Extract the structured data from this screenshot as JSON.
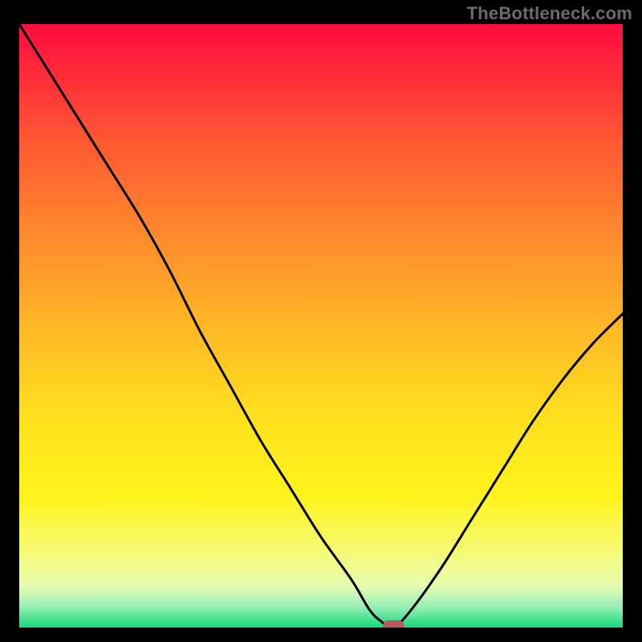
{
  "watermark": "TheBottleneck.com",
  "chart_data": {
    "type": "line",
    "title": "",
    "xlabel": "",
    "ylabel": "",
    "xlim": [
      0,
      100
    ],
    "ylim": [
      0,
      100
    ],
    "grid": false,
    "x": [
      0,
      5,
      10,
      15,
      20,
      25,
      30,
      35,
      40,
      45,
      50,
      55,
      58,
      60,
      62,
      65,
      70,
      75,
      80,
      85,
      90,
      95,
      100
    ],
    "values": [
      100,
      92,
      84,
      76,
      68,
      59,
      49,
      40,
      31,
      23,
      15,
      8,
      3,
      1,
      0,
      3,
      10,
      18,
      26,
      34,
      41,
      47,
      52
    ],
    "minimum_x": 62,
    "marker": {
      "x": 62,
      "y": 0
    },
    "gradient_stops": [
      {
        "offset": 0.0,
        "color": "#ff0d3f"
      },
      {
        "offset": 0.08,
        "color": "#ff2a3a"
      },
      {
        "offset": 0.2,
        "color": "#ff5a33"
      },
      {
        "offset": 0.35,
        "color": "#ff8a2d"
      },
      {
        "offset": 0.5,
        "color": "#ffb726"
      },
      {
        "offset": 0.65,
        "color": "#ffe01f"
      },
      {
        "offset": 0.78,
        "color": "#fff31a"
      },
      {
        "offset": 0.88,
        "color": "#f5fb7a"
      },
      {
        "offset": 0.93,
        "color": "#e7fbb0"
      },
      {
        "offset": 0.965,
        "color": "#9af0b8"
      },
      {
        "offset": 1.0,
        "color": "#17d97b"
      }
    ]
  }
}
